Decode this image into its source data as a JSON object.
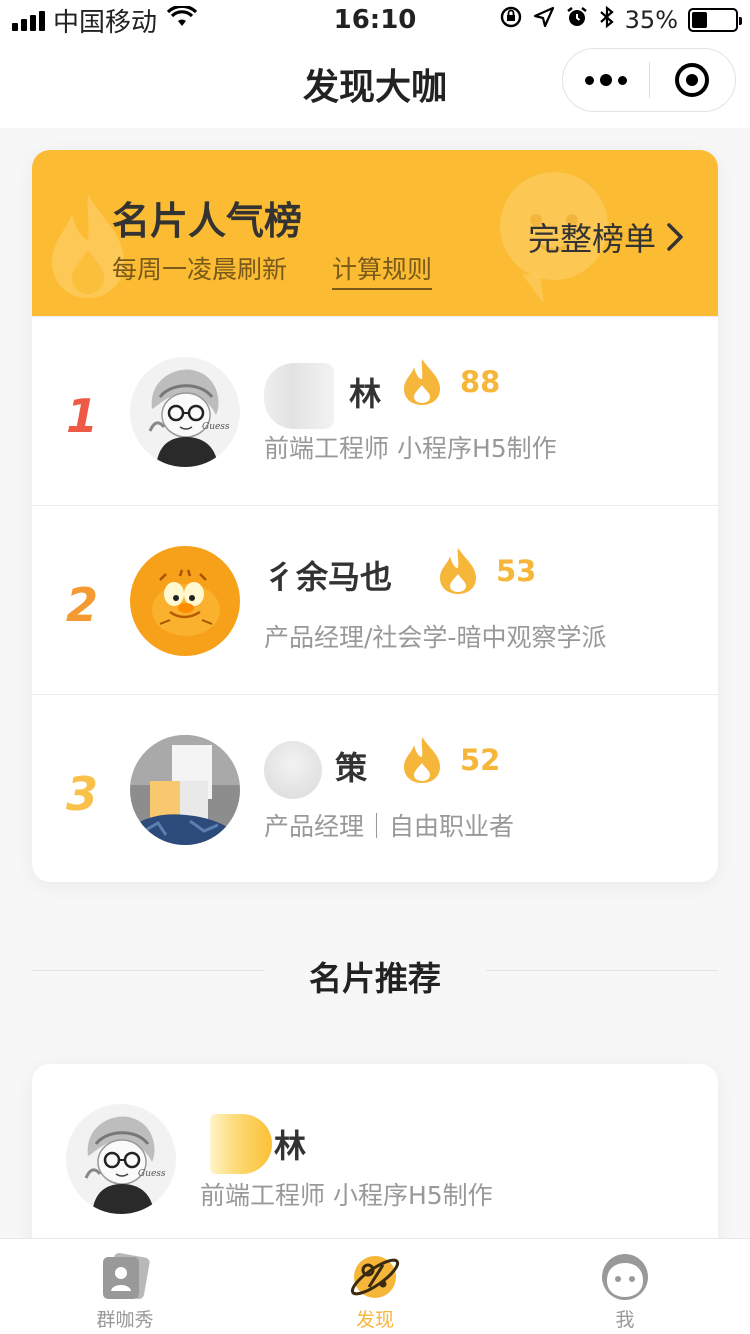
{
  "status_bar": {
    "carrier": "中国移动",
    "time": "16:10",
    "battery_text": "35%",
    "battery_level": 0.35
  },
  "nav": {
    "title": "发现大咖"
  },
  "ranking": {
    "title": "名片人气榜",
    "subtitle": "每周一凌晨刷新",
    "rule_link": "计算规则",
    "full_list": "完整榜单",
    "rows": [
      {
        "rank": "1",
        "name": "林",
        "score": "88",
        "desc": "前端工程师 小程序H5制作"
      },
      {
        "rank": "2",
        "name": "彳余马也",
        "score": "53",
        "desc": "产品经理/社会学-暗中观察学派"
      },
      {
        "rank": "3",
        "name": "策",
        "score": "52",
        "desc": "产品经理｜自由职业者"
      }
    ]
  },
  "recommend": {
    "section_title": "名片推荐",
    "name": "林",
    "desc": "前端工程师 小程序H5制作"
  },
  "tabbar": {
    "items": [
      {
        "label": "群咖秀",
        "icon": "card-icon"
      },
      {
        "label": "发现",
        "icon": "compass-icon"
      },
      {
        "label": "我",
        "icon": "face-icon"
      }
    ]
  },
  "colors": {
    "accent": "#fbbb32",
    "score": "#f6b63a",
    "rank1": "#ee5a45",
    "rank2": "#f59a33",
    "rank3": "#f9c04a"
  }
}
